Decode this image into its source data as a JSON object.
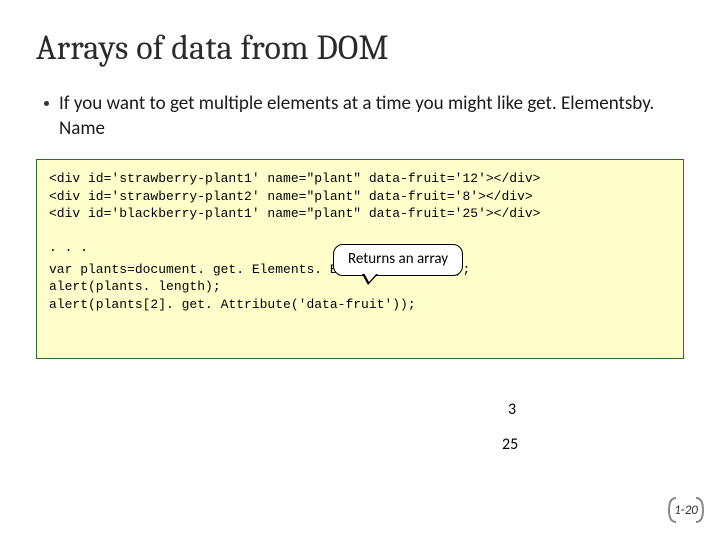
{
  "title": "Arrays of data from DOM",
  "bullet1": "If you want to get multiple elements at a time you might like get. Elementsby. Name",
  "code": {
    "line1": "<div id='strawberry-plant1' name=\"plant\" data-fruit='12'></div>",
    "line2": "<div id='strawberry-plant2' name=\"plant\" data-fruit='8'></div>",
    "line3": "<div id='blackberry-plant1' name=\"plant\" data-fruit='25'></div>",
    "ellipsis": ". . .",
    "line4": "var plants=document. get. Elements. By. Name(\"plant\");",
    "line5": "alert(plants. length);",
    "line6": "alert(plants[2]. get. Attribute('data-fruit'));"
  },
  "callout": "Returns an array",
  "results": {
    "r3": "3",
    "r25": "25"
  },
  "pagenum": "1-20"
}
